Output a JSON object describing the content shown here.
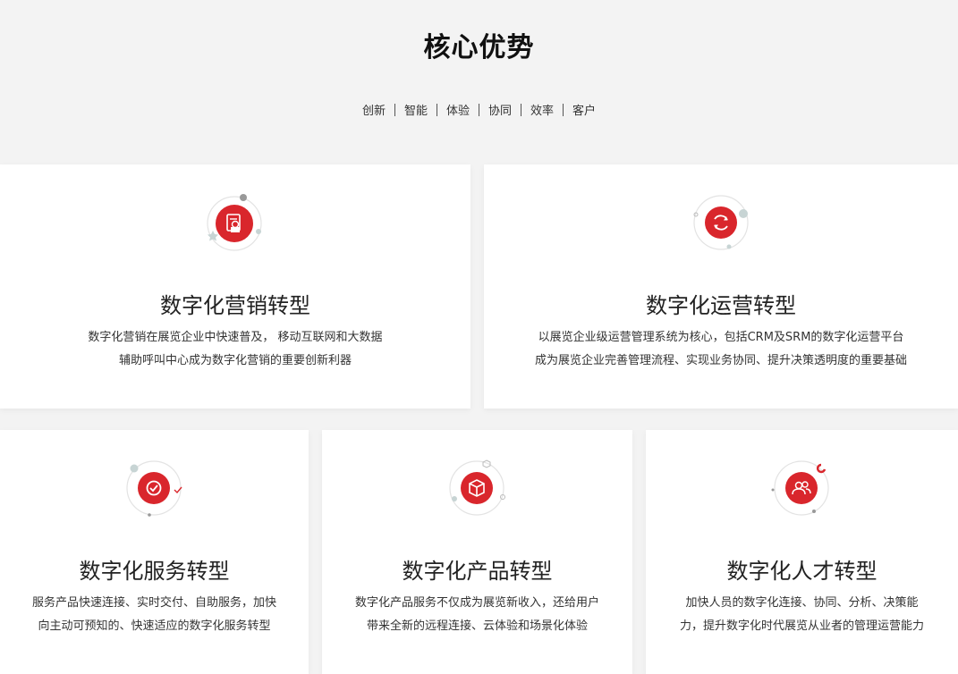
{
  "section": {
    "title": "核心优势",
    "tags": [
      "创新",
      "智能",
      "体验",
      "协同",
      "效率",
      "客户"
    ]
  },
  "colors": {
    "accent": "#d9262c",
    "background": "#f3f3f3",
    "card": "#ffffff"
  },
  "cards": [
    {
      "icon": "document-icon",
      "title": "数字化营销转型",
      "lines": [
        "数字化营销在展览企业中快速普及， 移动互联网和大数据",
        "辅助呼叫中心成为数字化营销的重要创新利器"
      ]
    },
    {
      "icon": "refresh-icon",
      "title": "数字化运营转型",
      "lines": [
        "以展览企业级运营管理系统为核心，包括CRM及SRM的数字化运营平台",
        "成为展览企业完善管理流程、实现业务协同、提升决策透明度的重要基础"
      ]
    },
    {
      "icon": "check-icon",
      "title": "数字化服务转型",
      "lines": [
        "服务产品快速连接、实时交付、自助服务，加快",
        "向主动可预知的、快速适应的数字化服务转型"
      ]
    },
    {
      "icon": "box-icon",
      "title": "数字化产品转型",
      "lines": [
        "数字化产品服务不仅成为展览新收入，还给用户",
        "带来全新的远程连接、云体验和场景化体验"
      ]
    },
    {
      "icon": "people-icon",
      "title": "数字化人才转型",
      "lines": [
        "加快人员的数字化连接、协同、分析、决策能",
        "力，提升数字化时代展览从业者的管理运营能力"
      ]
    }
  ]
}
